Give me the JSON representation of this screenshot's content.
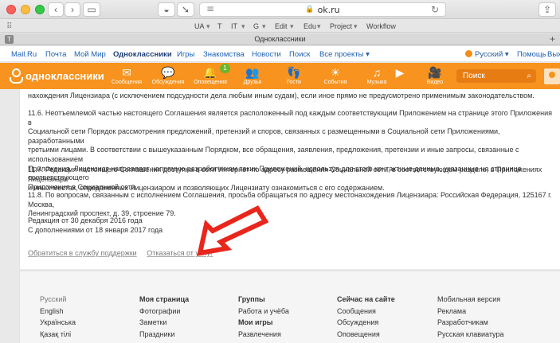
{
  "browser": {
    "url": "ok.ru",
    "tab_title": "Одноклассники",
    "tab_icon": "T",
    "bookmarks": [
      "UA",
      "T",
      "IT",
      "G",
      "Edit",
      "Edu",
      "Project",
      "Workflow"
    ]
  },
  "mailnav": {
    "items": [
      "Mail.Ru",
      "Почта",
      "Мой Мир",
      "Одноклассники",
      "Игры",
      "Знакомства",
      "Новости",
      "Поиск",
      "Все проекты ▾"
    ],
    "lang": "Русский ▾",
    "help": "Помощь",
    "exit": "Вых"
  },
  "okbar": {
    "logo": "одноклассники",
    "items": [
      "Сообщения",
      "Обсуждения",
      "Оповещения",
      "Друзья",
      "Гости",
      "События",
      "Музыка",
      "",
      "Видео"
    ],
    "badge": "1",
    "search_placeholder": "Поиск"
  },
  "content": {
    "line0": "нахождения Лицензиара (с исключением подсудности дела любым иным судам), если иное прямо не предусмотрено применимым законодательством.",
    "p116": [
      "11.6. Неотъемлемой частью настоящего Соглашения является расположенный под каждым соответствующим Приложением на странице этого Приложения в",
      "Социальной сети Порядок рассмотрения предложений, претензий и споров, связанных с размещенными в Социальной сети Приложениями, разработанными",
      "третьими лицами. В соответствии с вышеуказанным Порядком, все обращения, заявления, предложения, претензии и иные запросы, связанные с использованием",
      "Приложения, Лицензиат направляет напрямую разработчикам таких Приложений, используя для этого контактные данные, указанные на странице соответствующего",
      "Приложения в Социальной сети."
    ],
    "p117": [
      "11.7. Редакция настоящего Соглашения доступна в сети Интернет по адресу размещения Социальной сети, в соответствующем разделе, в Приложениях Лицензиара",
      "и иных местах, определенных Лицензиаром и позволяющих Лицензиату ознакомиться с его содержанием."
    ],
    "p118": [
      "11.8. По вопросам, связанным с исполнением Соглашения, просьба обращаться по адресу местонахождения Лицензиара: Российская Федерация, 125167 г. Москва,",
      "Ленинградский проспект, д. 39, строение 79."
    ],
    "edition": [
      "Редакция от 30 декабря 2016 года",
      "С дополнениями от 18 января 2017 года"
    ],
    "support_link": "Обратиться в службу поддержки",
    "refuse_link": "Отказаться от услуг"
  },
  "footer": {
    "langs": [
      "Русский",
      "English",
      "Українська",
      "Қазақ тілі"
    ],
    "col2_title": "Моя страница",
    "col2": [
      "Фотографии",
      "Заметки",
      "Праздники"
    ],
    "col3_title": "Группы",
    "col3": [
      "Работа и учёба"
    ],
    "col3b_title": "Мои игры",
    "col3b": [
      "Развлечения"
    ],
    "col4_title": "Сейчас на сайте",
    "col4": [
      "Сообщения",
      "Обсуждения",
      "Оповещения"
    ],
    "col5": [
      "Мобильная версия",
      "Реклама",
      "Разработчикам",
      "Русская клавиатура"
    ]
  },
  "colors": {
    "ok_orange": "#f7931e",
    "link_blue": "#1a5fb4",
    "arrow_red": "#e8261c"
  }
}
